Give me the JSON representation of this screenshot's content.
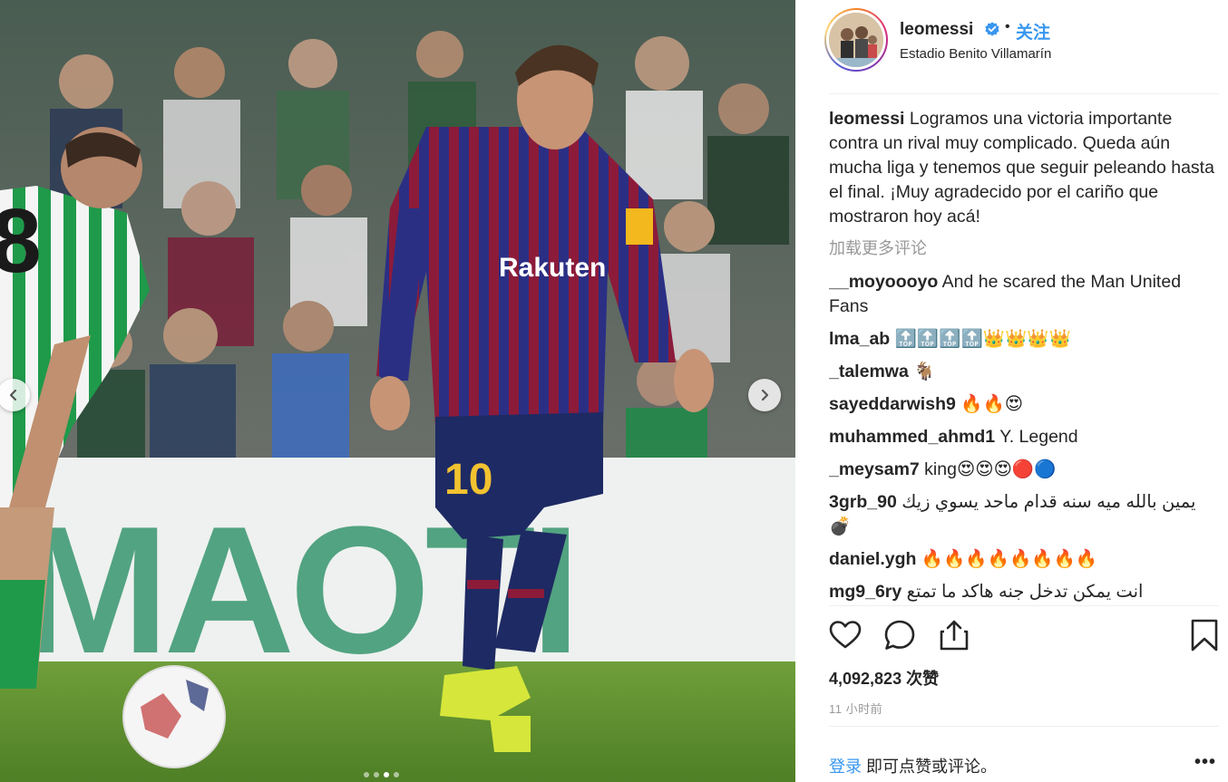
{
  "post": {
    "username": "leomessi",
    "location": "Estadio Benito Villamarín",
    "follow_label": "关注",
    "bullet": "•",
    "caption_user": "leomessi",
    "caption_text": "Logramos una victoria importante contra un rival muy complicado. Queda aún mucha liga y tenemos que seguir peleando hasta el final. ¡Muy agradecido por el cariño que mostraron hoy acá!",
    "load_more": "加载更多评论",
    "likes": "4,092,823 次赞",
    "time": "11 小时前",
    "login_link": "登录",
    "login_text": " 即可点赞或评论。",
    "more": "•••"
  },
  "comments": [
    {
      "user": "__moyoooyo",
      "text": "And he scared the Man United Fans"
    },
    {
      "user": "lma_ab",
      "text": "🔝🔝🔝🔝👑👑👑👑"
    },
    {
      "user": "_talemwa",
      "text": "🐐"
    },
    {
      "user": "sayeddarwish9",
      "text": "🔥🔥😍"
    },
    {
      "user": "muhammed_ahmd1",
      "text": "Y. Legend"
    },
    {
      "user": "_meysam7",
      "text": "king😍😍😍🔴🔵"
    },
    {
      "user": "3grb_90",
      "text": "يمين بالله ميه سنه قدام ماحد يسوي زيك 💣"
    },
    {
      "user": "daniel.ygh",
      "text": "🔥🔥🔥🔥🔥🔥🔥🔥"
    },
    {
      "user": "mg9_6ry",
      "text": "انت يمكن تدخل جنه هاكد ما تمتع"
    }
  ],
  "photo": {
    "sponsor": "Rakuten",
    "shirt_number": "10",
    "opponent_number": "8",
    "board_text": "MAOTI",
    "carousel_total": 4,
    "carousel_active": 3
  },
  "icons": {
    "prev": "chevron-left-icon",
    "next": "chevron-right-icon",
    "like": "heart-icon",
    "comment": "comment-icon",
    "share": "share-icon",
    "save": "bookmark-icon",
    "verified": "verified-badge-icon"
  },
  "colors": {
    "link_blue": "#3897f0",
    "verified_blue": "#3897f0",
    "muted_gray": "#999999"
  }
}
